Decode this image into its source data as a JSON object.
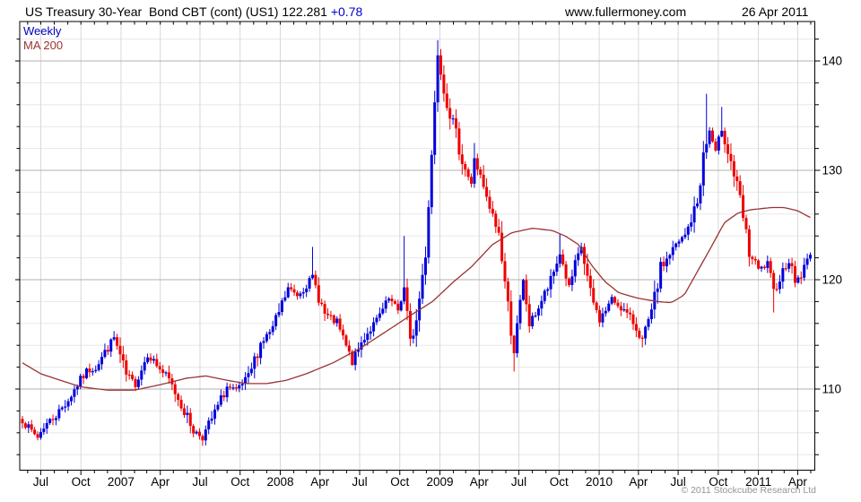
{
  "header": {
    "title": "US Treasury 30-Year  Bond CBT (cont) (US1)",
    "last_price": "122.281",
    "change": "+0.78",
    "website": "www.fullermoney.com",
    "date": "26 Apr 2011"
  },
  "legend": {
    "timeframe": "Weekly",
    "overlay": "MA 200"
  },
  "footer": {
    "copyright": "© 2011 Stockcube Research Ltd"
  },
  "colors": {
    "up_candle": "#0000dd",
    "down_candle": "#ee0000",
    "ma_line": "#993333",
    "change_text": "#0000cc",
    "grid_minor": "#e8e8e8",
    "grid_major": "#b0b0b0",
    "grid_vertical": "#d8d8d8",
    "axis": "#000000",
    "copyright_text": "#949494"
  },
  "chart_data": {
    "type": "candlestick",
    "interval": "weekly",
    "instrument": "US Treasury 30-Year Bond CBT (cont) (US1)",
    "last_close": 122.281,
    "change": 0.78,
    "high": 141.9,
    "low": 104.8,
    "weeks": 259,
    "x_range": [
      "2006-05-20",
      "2011-04-29"
    ],
    "ylim": [
      102.6,
      143.6
    ],
    "y_axis": {
      "major_ticks": [
        110,
        120,
        130,
        140
      ],
      "minor_step": 2
    },
    "x_ticks": [
      {
        "date": "2006-07-01",
        "label": "Jul"
      },
      {
        "date": "2006-10-01",
        "label": "Oct"
      },
      {
        "date": "2007-01-01",
        "label": "2007"
      },
      {
        "date": "2007-04-01",
        "label": "Apr"
      },
      {
        "date": "2007-07-01",
        "label": "Jul"
      },
      {
        "date": "2007-10-01",
        "label": "Oct"
      },
      {
        "date": "2008-01-01",
        "label": "2008"
      },
      {
        "date": "2008-04-01",
        "label": "Apr"
      },
      {
        "date": "2008-07-01",
        "label": "Jul"
      },
      {
        "date": "2008-10-01",
        "label": "Oct"
      },
      {
        "date": "2009-01-01",
        "label": "2009"
      },
      {
        "date": "2009-04-01",
        "label": "Apr"
      },
      {
        "date": "2009-07-01",
        "label": "Jul"
      },
      {
        "date": "2009-10-01",
        "label": "Oct"
      },
      {
        "date": "2010-01-01",
        "label": "2010"
      },
      {
        "date": "2010-04-01",
        "label": "Apr"
      },
      {
        "date": "2010-07-01",
        "label": "Jul"
      },
      {
        "date": "2010-10-01",
        "label": "Oct"
      },
      {
        "date": "2011-01-01",
        "label": "2011"
      },
      {
        "date": "2011-04-01",
        "label": "Apr"
      }
    ],
    "price_anchors_weekly_close": [
      [
        "2006-05-20",
        107.2
      ],
      [
        "2006-06-03",
        106.4
      ],
      [
        "2006-06-24",
        105.6
      ],
      [
        "2006-07-08",
        106.6
      ],
      [
        "2006-08-05",
        107.6
      ],
      [
        "2006-09-02",
        109.0
      ],
      [
        "2006-09-23",
        110.4
      ],
      [
        "2006-10-14",
        111.6
      ],
      [
        "2006-11-04",
        112.0
      ],
      [
        "2006-12-02",
        113.8
      ],
      [
        "2006-12-16",
        114.7
      ],
      [
        "2007-01-13",
        111.2
      ],
      [
        "2007-02-03",
        110.5
      ],
      [
        "2007-03-03",
        113.2
      ],
      [
        "2007-03-24",
        112.2
      ],
      [
        "2007-04-21",
        110.8
      ],
      [
        "2007-05-19",
        108.6
      ],
      [
        "2007-06-16",
        106.2
      ],
      [
        "2007-07-07",
        105.6
      ],
      [
        "2007-08-04",
        107.8
      ],
      [
        "2007-09-01",
        110.2
      ],
      [
        "2007-09-22",
        109.8
      ],
      [
        "2007-10-20",
        111.0
      ],
      [
        "2007-11-17",
        114.2
      ],
      [
        "2007-12-15",
        115.5
      ],
      [
        "2008-01-19",
        119.2
      ],
      [
        "2008-02-09",
        118.6
      ],
      [
        "2008-03-15",
        120.2
      ],
      [
        "2008-04-12",
        116.8
      ],
      [
        "2008-05-10",
        116.0
      ],
      [
        "2008-06-14",
        112.4
      ],
      [
        "2008-07-12",
        114.8
      ],
      [
        "2008-08-09",
        116.2
      ],
      [
        "2008-09-06",
        118.2
      ],
      [
        "2008-09-27",
        117.2
      ],
      [
        "2008-10-11",
        119.2
      ],
      [
        "2008-10-25",
        114.2
      ],
      [
        "2008-11-08",
        116.2
      ],
      [
        "2008-11-29",
        122.5
      ],
      [
        "2008-12-13",
        131.5
      ],
      [
        "2008-12-27",
        141.0
      ],
      [
        "2009-01-10",
        137.5
      ],
      [
        "2009-01-31",
        134.2
      ],
      [
        "2009-02-21",
        131.0
      ],
      [
        "2009-03-14",
        128.6
      ],
      [
        "2009-03-21",
        131.2
      ],
      [
        "2009-04-18",
        127.2
      ],
      [
        "2009-05-16",
        124.2
      ],
      [
        "2009-06-06",
        117.6
      ],
      [
        "2009-06-20",
        113.4
      ],
      [
        "2009-07-11",
        119.8
      ],
      [
        "2009-07-25",
        115.9
      ],
      [
        "2009-08-15",
        117.5
      ],
      [
        "2009-09-12",
        119.8
      ],
      [
        "2009-10-03",
        122.4
      ],
      [
        "2009-10-24",
        119.3
      ],
      [
        "2009-11-21",
        123.0
      ],
      [
        "2009-12-12",
        118.6
      ],
      [
        "2010-01-02",
        116.3
      ],
      [
        "2010-01-30",
        118.2
      ],
      [
        "2010-02-20",
        117.5
      ],
      [
        "2010-03-20",
        116.1
      ],
      [
        "2010-04-10",
        114.5
      ],
      [
        "2010-05-01",
        116.8
      ],
      [
        "2010-05-22",
        121.0
      ],
      [
        "2010-06-19",
        122.8
      ],
      [
        "2010-07-17",
        124.0
      ],
      [
        "2010-08-14",
        127.0
      ],
      [
        "2010-08-28",
        131.3
      ],
      [
        "2010-09-11",
        133.6
      ],
      [
        "2010-09-25",
        131.6
      ],
      [
        "2010-10-09",
        133.8
      ],
      [
        "2010-10-30",
        130.8
      ],
      [
        "2010-11-20",
        127.2
      ],
      [
        "2010-12-11",
        122.4
      ],
      [
        "2011-01-01",
        120.9
      ],
      [
        "2011-01-22",
        121.3
      ],
      [
        "2011-02-05",
        118.9
      ],
      [
        "2011-02-26",
        120.8
      ],
      [
        "2011-03-12",
        121.8
      ],
      [
        "2011-03-26",
        119.9
      ],
      [
        "2011-04-09",
        120.4
      ],
      [
        "2011-04-29",
        122.281
      ]
    ],
    "ma200_anchors": [
      [
        "2006-05-20",
        112.4
      ],
      [
        "2006-07-01",
        111.4
      ],
      [
        "2006-08-15",
        110.8
      ],
      [
        "2006-10-01",
        110.2
      ],
      [
        "2006-12-01",
        109.9
      ],
      [
        "2007-02-01",
        109.9
      ],
      [
        "2007-04-01",
        110.4
      ],
      [
        "2007-06-01",
        111.0
      ],
      [
        "2007-07-15",
        111.2
      ],
      [
        "2007-09-01",
        110.8
      ],
      [
        "2007-10-15",
        110.5
      ],
      [
        "2007-12-01",
        110.5
      ],
      [
        "2008-01-15",
        110.8
      ],
      [
        "2008-03-01",
        111.4
      ],
      [
        "2008-05-01",
        112.4
      ],
      [
        "2008-07-01",
        113.7
      ],
      [
        "2008-09-01",
        115.3
      ],
      [
        "2008-11-01",
        116.9
      ],
      [
        "2008-12-15",
        118.0
      ],
      [
        "2009-02-01",
        119.8
      ],
      [
        "2009-03-15",
        121.2
      ],
      [
        "2009-05-01",
        123.2
      ],
      [
        "2009-06-15",
        124.3
      ],
      [
        "2009-08-01",
        124.7
      ],
      [
        "2009-09-15",
        124.5
      ],
      [
        "2009-10-15",
        124.0
      ],
      [
        "2009-11-15",
        123.2
      ],
      [
        "2009-12-15",
        121.3
      ],
      [
        "2010-01-15",
        119.8
      ],
      [
        "2010-02-15",
        118.8
      ],
      [
        "2010-04-01",
        118.3
      ],
      [
        "2010-05-15",
        118.0
      ],
      [
        "2010-06-15",
        117.9
      ],
      [
        "2010-07-15",
        118.6
      ],
      [
        "2010-08-15",
        120.8
      ],
      [
        "2010-09-15",
        123.0
      ],
      [
        "2010-10-15",
        125.2
      ],
      [
        "2010-11-15",
        126.1
      ],
      [
        "2010-12-15",
        126.4
      ],
      [
        "2011-02-01",
        126.6
      ],
      [
        "2011-03-01",
        126.6
      ],
      [
        "2011-04-01",
        126.3
      ],
      [
        "2011-04-29",
        125.7
      ]
    ],
    "wick_extremes": [
      {
        "date": "2006-12-16",
        "high": 115.3
      },
      {
        "date": "2007-07-07",
        "low": 104.8
      },
      {
        "date": "2008-03-15",
        "high": 123.0
      },
      {
        "date": "2008-10-11",
        "high": 124.0
      },
      {
        "date": "2008-12-27",
        "high": 141.9
      },
      {
        "date": "2009-03-21",
        "high": 132.5
      },
      {
        "date": "2009-06-20",
        "low": 111.6
      },
      {
        "date": "2009-10-03",
        "high": 124.2
      },
      {
        "date": "2010-04-10",
        "low": 113.8
      },
      {
        "date": "2010-09-04",
        "high": 137.0
      },
      {
        "date": "2010-10-09",
        "high": 135.8
      },
      {
        "date": "2011-02-05",
        "low": 117.0
      }
    ]
  }
}
